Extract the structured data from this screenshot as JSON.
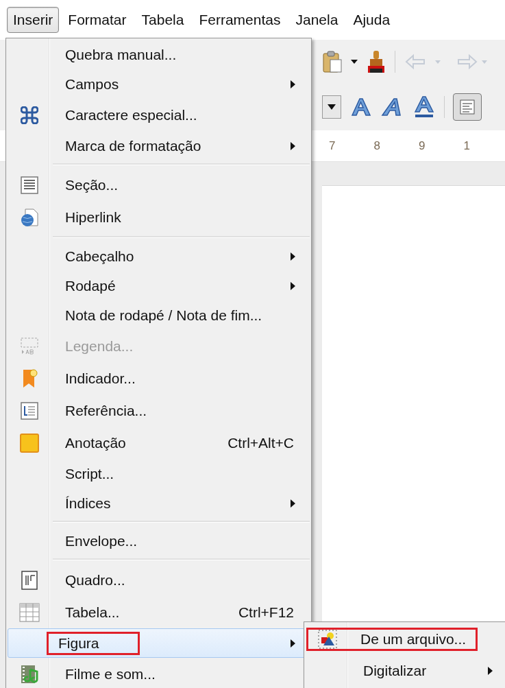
{
  "menubar": [
    {
      "label": "Inserir",
      "selected": true
    },
    {
      "label": "Formatar",
      "selected": false
    },
    {
      "label": "Tabela",
      "selected": false
    },
    {
      "label": "Ferramentas",
      "selected": false
    },
    {
      "label": "Janela",
      "selected": false
    },
    {
      "label": "Ajuda",
      "selected": false
    }
  ],
  "ruler": [
    "7",
    "8",
    "9",
    "1"
  ],
  "menu": [
    {
      "kind": "item",
      "label": "Quebra manual...",
      "submenu": false,
      "disabled": false,
      "selected": false
    },
    {
      "kind": "item",
      "label": "Campos",
      "submenu": true,
      "disabled": false,
      "selected": false
    },
    {
      "kind": "item",
      "label": "Caractere especial...",
      "submenu": false,
      "disabled": false,
      "selected": false
    },
    {
      "kind": "item",
      "label": "Marca de formatação",
      "submenu": true,
      "disabled": false,
      "selected": false
    },
    {
      "kind": "separator"
    },
    {
      "kind": "item",
      "label": "Seção...",
      "submenu": false,
      "disabled": false,
      "selected": false
    },
    {
      "kind": "item",
      "label": "Hiperlink",
      "submenu": false,
      "disabled": false,
      "selected": false
    },
    {
      "kind": "separator"
    },
    {
      "kind": "item",
      "label": "Cabeçalho",
      "submenu": true,
      "disabled": false,
      "selected": false
    },
    {
      "kind": "item",
      "label": "Rodapé",
      "submenu": true,
      "disabled": false,
      "selected": false
    },
    {
      "kind": "item",
      "label": "Nota de rodapé / Nota de fim...",
      "submenu": false,
      "disabled": false,
      "selected": false
    },
    {
      "kind": "item",
      "label": "Legenda...",
      "submenu": false,
      "disabled": true,
      "selected": false
    },
    {
      "kind": "item",
      "label": "Indicador...",
      "submenu": false,
      "disabled": false,
      "selected": false
    },
    {
      "kind": "item",
      "label": "Referência...",
      "submenu": false,
      "disabled": false,
      "selected": false
    },
    {
      "kind": "item",
      "label": "Anotação",
      "shortcut": "Ctrl+Alt+C",
      "submenu": false,
      "disabled": false,
      "selected": false
    },
    {
      "kind": "item",
      "label": "Script...",
      "submenu": false,
      "disabled": false,
      "selected": false
    },
    {
      "kind": "item",
      "label": "Índices",
      "submenu": true,
      "disabled": false,
      "selected": false
    },
    {
      "kind": "separator"
    },
    {
      "kind": "item",
      "label": "Envelope...",
      "submenu": false,
      "disabled": false,
      "selected": false
    },
    {
      "kind": "separator"
    },
    {
      "kind": "item",
      "label": "Quadro...",
      "submenu": false,
      "disabled": false,
      "selected": false
    },
    {
      "kind": "item",
      "label": "Tabela...",
      "shortcut": "Ctrl+F12",
      "submenu": false,
      "disabled": false,
      "selected": false
    },
    {
      "kind": "item",
      "label": "Figura",
      "submenu": true,
      "disabled": false,
      "selected": true,
      "annotated": true
    },
    {
      "kind": "item",
      "label": "Filme e som...",
      "submenu": false,
      "disabled": false,
      "selected": false
    }
  ],
  "submenu": [
    {
      "label": "De um arquivo...",
      "submenu": false,
      "selected": false,
      "annotated": true
    },
    {
      "label": "Digitalizar",
      "submenu": true,
      "selected": false,
      "annotated": false
    }
  ]
}
